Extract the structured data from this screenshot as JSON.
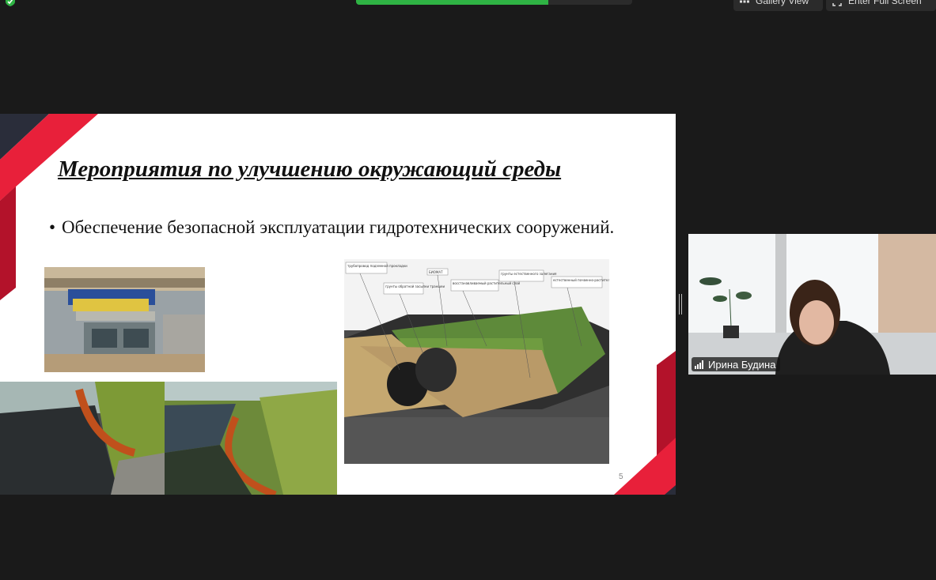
{
  "toolbar": {
    "gallery_view_label": "Gallery View",
    "full_screen_label": "Enter Full Screen",
    "share_status_color": "#2fb344"
  },
  "slide": {
    "title": "Мероприятия по улучшению окружающий среды",
    "bullet_symbol": "•",
    "bullet_text": "Обеспечение безопасной эксплуатации гидротехнических сооружений.",
    "page_number": "5",
    "accent_color": "#e8203a",
    "diagram_labels": [
      "трубопровод подземной прокладки",
      "грунты обратной засыпки траншеи",
      "БИОМАТ",
      "восстанавливаемый растительный слой",
      "грунты естественного залегания",
      "естественный почвенно-растительный слой"
    ]
  },
  "participant": {
    "name": "Ирина Будина"
  },
  "icons": {
    "security": "shield-check-icon",
    "gallery": "grid-icon",
    "fullscreen": "expand-icon",
    "signal": "signal-bars-icon"
  }
}
